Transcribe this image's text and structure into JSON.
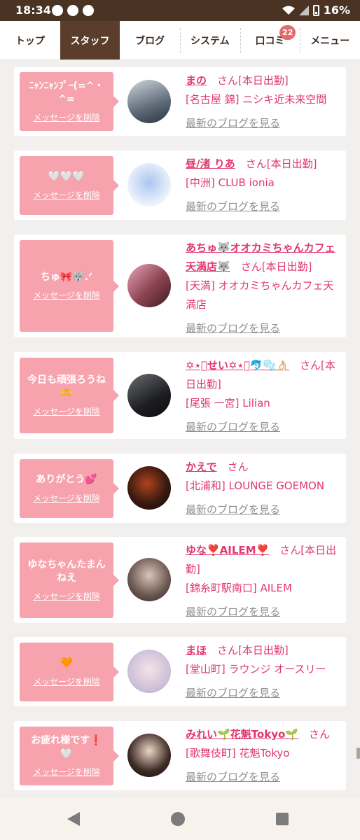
{
  "status_bar": {
    "time": "18:34",
    "battery": "16%"
  },
  "tabs": [
    {
      "label": "トップ"
    },
    {
      "label": "スタッフ"
    },
    {
      "label": "ブログ"
    },
    {
      "label": "システム"
    },
    {
      "label": "口コミ",
      "badge": "22"
    },
    {
      "label": "メニュー"
    }
  ],
  "delete_label": "メッセージを削除",
  "blog_link_label": "最新のブログを見る",
  "cards": [
    {
      "message": "ﾆｬﾝﾆｬﾝﾌﾟｰ(=^・^=",
      "name": "まの",
      "suffix": "さん[本日出勤]",
      "shop": "[名古屋 錦] ニシキ近未来空間"
    },
    {
      "message": "🤍🤍🤍",
      "name": "昼/渚 りあ",
      "suffix": "さん[本日出勤]",
      "shop": "[中洲] CLUB ionia"
    },
    {
      "message": "ちゅ🎀🐺.ᐟ",
      "name": "あちゅ🐺オオカミちゃんカフェ天満店🐺",
      "suffix": "さん[本日出勤]",
      "shop": "[天満] オオカミちゃんカフェ天満店"
    },
    {
      "message": "今日も頑張ろうね🫶",
      "name": "✡︎⋆͛せい✡︎⋆͛🐬🫧👌🏻",
      "suffix": "さん[本日出勤]",
      "shop": "[尾張 一宮] Lilian"
    },
    {
      "message": "ありがとう💕",
      "name": "かえで",
      "suffix": "さん",
      "shop": "[北浦和] LOUNGE GOEMON"
    },
    {
      "message": "ゆなちゃんたまんねえ",
      "name": "ゆな❣️AILEM❣️",
      "suffix": "さん[本日出勤]",
      "shop": "[錦糸町駅南口] AILEM"
    },
    {
      "message": "🧡",
      "name": "まほ",
      "suffix": "さん[本日出勤]",
      "shop": "[堂山町] ラウンジ オースリー"
    },
    {
      "message": "お疲れ様です❗️🤍",
      "name": "みれい🌱花魁Tokyo🌱",
      "suffix": "さん",
      "shop": "[歌舞伎町] 花魁Tokyo"
    }
  ]
}
